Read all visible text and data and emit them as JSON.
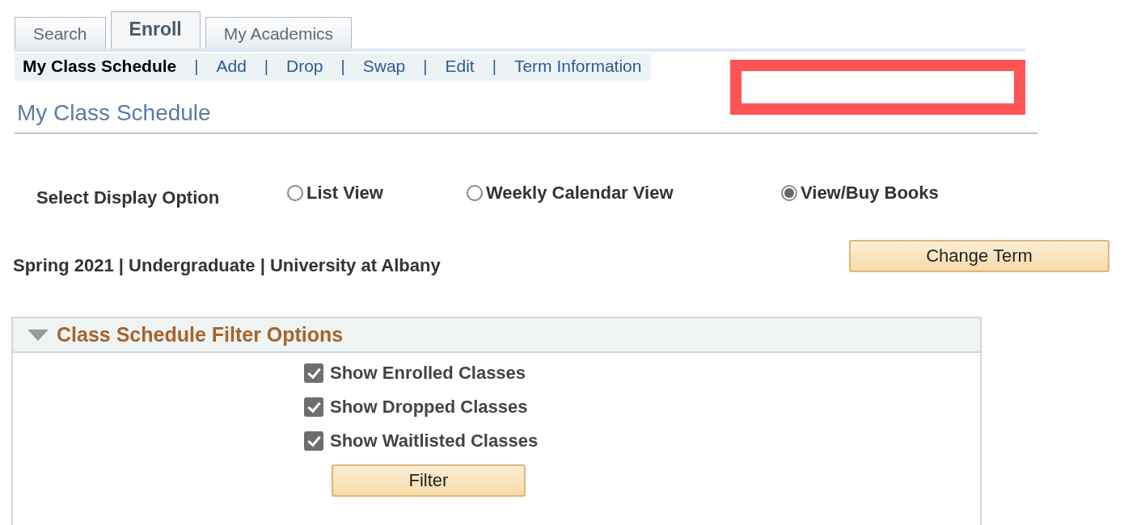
{
  "tabs": [
    {
      "label": "Search",
      "selected": false
    },
    {
      "label": "Enroll",
      "selected": true
    },
    {
      "label": "My Academics",
      "selected": false
    }
  ],
  "subnav": [
    {
      "label": "My Class Schedule",
      "selected": true
    },
    {
      "label": "Add",
      "selected": false
    },
    {
      "label": "Drop",
      "selected": false
    },
    {
      "label": "Swap",
      "selected": false
    },
    {
      "label": "Edit",
      "selected": false
    },
    {
      "label": "Term Information",
      "selected": false
    }
  ],
  "subnav_separator": "|",
  "page_title": "My Class Schedule",
  "display_option": {
    "label": "Select Display Option",
    "options": [
      {
        "label": "List View",
        "selected": false
      },
      {
        "label": "Weekly Calendar View",
        "selected": false
      },
      {
        "label": "View/Buy Books",
        "selected": true
      }
    ]
  },
  "term": {
    "text": "Spring 2021 | Undergraduate | University at Albany",
    "button": "Change Term"
  },
  "filter_panel": {
    "title": "Class Schedule Filter Options",
    "expanded": true,
    "options": [
      {
        "label": "Show Enrolled Classes",
        "checked": true
      },
      {
        "label": "Show Dropped Classes",
        "checked": true
      },
      {
        "label": "Show Waitlisted Classes",
        "checked": true
      }
    ],
    "button": "Filter"
  }
}
